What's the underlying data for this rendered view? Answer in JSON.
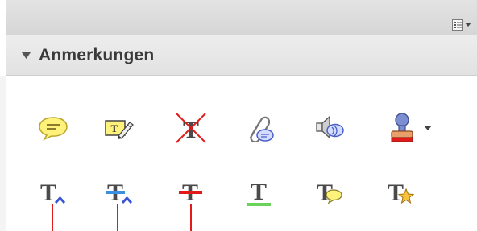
{
  "panel": {
    "title": "Anmerkungen"
  },
  "icons": {
    "row1": [
      "sticky-note-icon",
      "text-edit-icon",
      "strikeout-text-icon",
      "attach-file-icon",
      "record-audio-icon",
      "stamp-icon"
    ],
    "row2": [
      "insert-text-icon",
      "replace-text-icon",
      "strikethrough-text-icon",
      "underline-text-icon",
      "text-comment-icon",
      "highlight-text-icon"
    ]
  },
  "colors": {
    "accent_red": "#e21a1a",
    "note_yellow": "#fff27a",
    "caret_blue": "#3a56d6",
    "underline_green": "#6bd35c"
  }
}
